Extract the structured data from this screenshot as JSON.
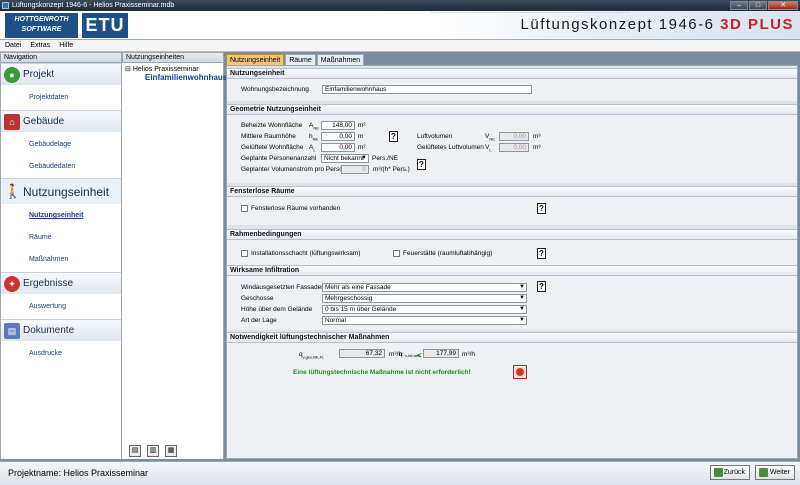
{
  "window": {
    "title": "Lüftungskonzept 1946-6 - Helios Praxisseminar.mdb",
    "controls": [
      "–",
      "□",
      "✕"
    ]
  },
  "banner": {
    "logo_line1": "HOTTGENROTH",
    "logo_line2": "SOFTWARE",
    "etu": "ETU",
    "title": "Lüftungskonzept 1946-6 ",
    "title_plus": "3D PLUS"
  },
  "menu": [
    "Datei",
    "Extras",
    "Hilfe"
  ],
  "nav": {
    "header": "Navigation",
    "projekt": {
      "title": "Projekt",
      "items": [
        "Projektdaten"
      ]
    },
    "gebaeude": {
      "title": "Gebäude",
      "items": [
        "Gebäudelage",
        "Gebäudedaten"
      ]
    },
    "nutzung": {
      "title": "Nutzungseinheit",
      "items": [
        "Nutzungseinheit",
        "Räume",
        "Maßnahmen"
      ]
    },
    "ergebnisse": {
      "title": "Ergebnisse",
      "items": [
        "Auswertung"
      ]
    },
    "dokumente": {
      "title": "Dokumente",
      "items": [
        "Ausdrucke"
      ]
    }
  },
  "tree": {
    "header": "Nutzungseinheiten",
    "root": "Helios Praxisseminar",
    "child": "Einfamilienwohnhaus",
    "buttons": [
      "▤",
      "▥",
      "▦"
    ]
  },
  "tabs": [
    "Nutzungseinheit",
    "Räume",
    "Maßnahmen"
  ],
  "sections": {
    "nutzungseinheit": {
      "title": "Nutzungseinheit",
      "label": "Wohnungsbezeichnung",
      "value": "Einfamilienwohnhaus"
    },
    "geometrie": {
      "title": "Geometrie Nutzungseinheit",
      "beheizte": {
        "label": "Beheizte Wohnfläche",
        "sym": "A",
        "sub": "NE",
        "value": "148,00",
        "unit": "m²"
      },
      "raumhoehe": {
        "label": "Mittlere Raumhöhe",
        "sym": "h",
        "sub": "NE",
        "value": "0,00",
        "unit": "m"
      },
      "gelueftete": {
        "label": "Gelüftete Wohnfläche",
        "sym": "A",
        "sub": "L",
        "value": "0,00",
        "unit": "m²"
      },
      "personen": {
        "label": "Geplante Personenanzahl",
        "value": "Nicht bekannt",
        "unit": "Pers./NE"
      },
      "volumenstrom": {
        "label": "Geplanter Volumenstrom pro Person",
        "value": "0",
        "unit": "m³/(h* Pers.)"
      },
      "luftvolumen": {
        "label": "Luftvolumen",
        "sym": "V",
        "sub": "NE",
        "value": "0,00",
        "unit": "m³"
      },
      "gel_luftvolumen": {
        "label": "Gelüftetes Luftvolumen",
        "sym": "V",
        "sub": "L",
        "value": "0,00",
        "unit": "m³"
      }
    },
    "fensterlos": {
      "title": "Fensterlose Räume",
      "checkbox": "Fensterlose Räume vorhanden"
    },
    "rahmen": {
      "title": "Rahmenbedingungen",
      "cb1": "Installationsschacht (lüftungswirksam)",
      "cb2": "Feuerstätte (raumluftabhängig)"
    },
    "infiltration": {
      "title": "Wirksame Infiltration",
      "rows": [
        {
          "label": "Windausgesetzten Fassaden",
          "value": "Mehr als eine Fassade"
        },
        {
          "label": "Geschosse",
          "value": "Mehrgeschossig"
        },
        {
          "label": "Höhe über dem Gelände",
          "value": "0 bis 15 m über Gelände"
        },
        {
          "label": "Art der Lage",
          "value": "Normal"
        }
      ]
    },
    "notwendigkeit": {
      "title": "Notwendigkeit lüftungstechnischer Maßnahmen",
      "q1_label": "q",
      "q1_sub": "v,ges,NE,FL",
      "q1_value": "67,32",
      "q1_unit": "m³/h",
      "lt": "<",
      "q2_label": "q",
      "q2_sub": "v,Inf,wirk",
      "q2_value": "177,99",
      "q2_unit": "m³/h",
      "message": "Eine lüftungstechnische Maßnahme ist nicht erforderlich!"
    }
  },
  "help": "?",
  "status": {
    "project": "Projektname: Helios Praxisseminar",
    "back": "Zurück",
    "next": "Weiter"
  }
}
